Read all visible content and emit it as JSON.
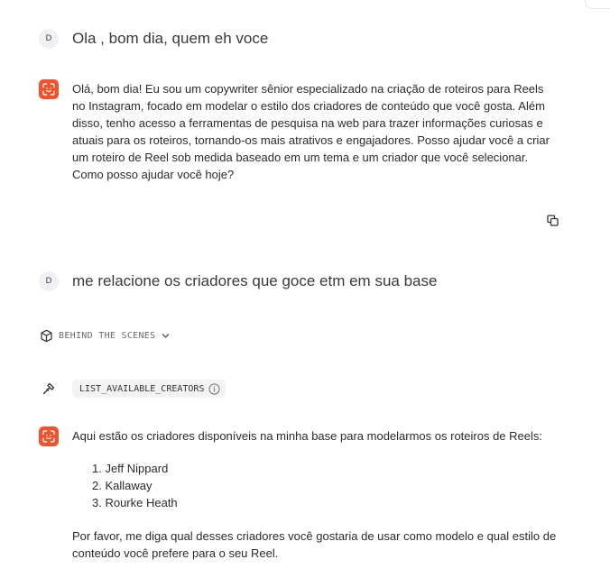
{
  "conversation": {
    "user_messages": [
      {
        "avatar": "D",
        "text": "Ola , bom dia, quem eh voce"
      },
      {
        "avatar": "D",
        "text": "me relacione os criadores que goce etm em sua base"
      }
    ],
    "assistant_intro": "Olá, bom dia! Eu sou um copywriter sênior especializado na criação de roteiros para Reels no Instagram, focado em modelar o estilo dos criadores de conteúdo que você gosta. Além disso, tenho acesso a ferramentas de pesquisa na web para trazer informações curiosas e atuais para os roteiros, tornando-os mais atrativos e engajadores. Posso ajudar você a criar um roteiro de Reel sob medida baseado em um tema e um criador que você selecionar. Como posso ajudar você hoje?",
    "behind_the_scenes_label": "BEHIND THE SCENES",
    "tool_call": {
      "name": "LIST_AVAILABLE_CREATORS",
      "icon": "hammer-icon"
    },
    "assistant_list_intro": "Aqui estão os criadores disponíveis na minha base para modelarmos os roteiros de Reels:",
    "creators": [
      "1. Jeff Nippard",
      "2. Kallaway",
      "3. Rourke Heath"
    ],
    "assistant_outro": "Por favor, me diga qual desses criadores você gostaria de usar como modelo e qual estilo de conteúdo você prefere para o seu Reel."
  },
  "colors": {
    "assistant_accent": "#f4522b"
  },
  "icons": {
    "assistant_avatar": "focus-scan-icon",
    "copy": "copy-icon",
    "behind_the_scenes": "cube-icon",
    "expand": "chevron-down-icon",
    "info": "info-icon"
  }
}
